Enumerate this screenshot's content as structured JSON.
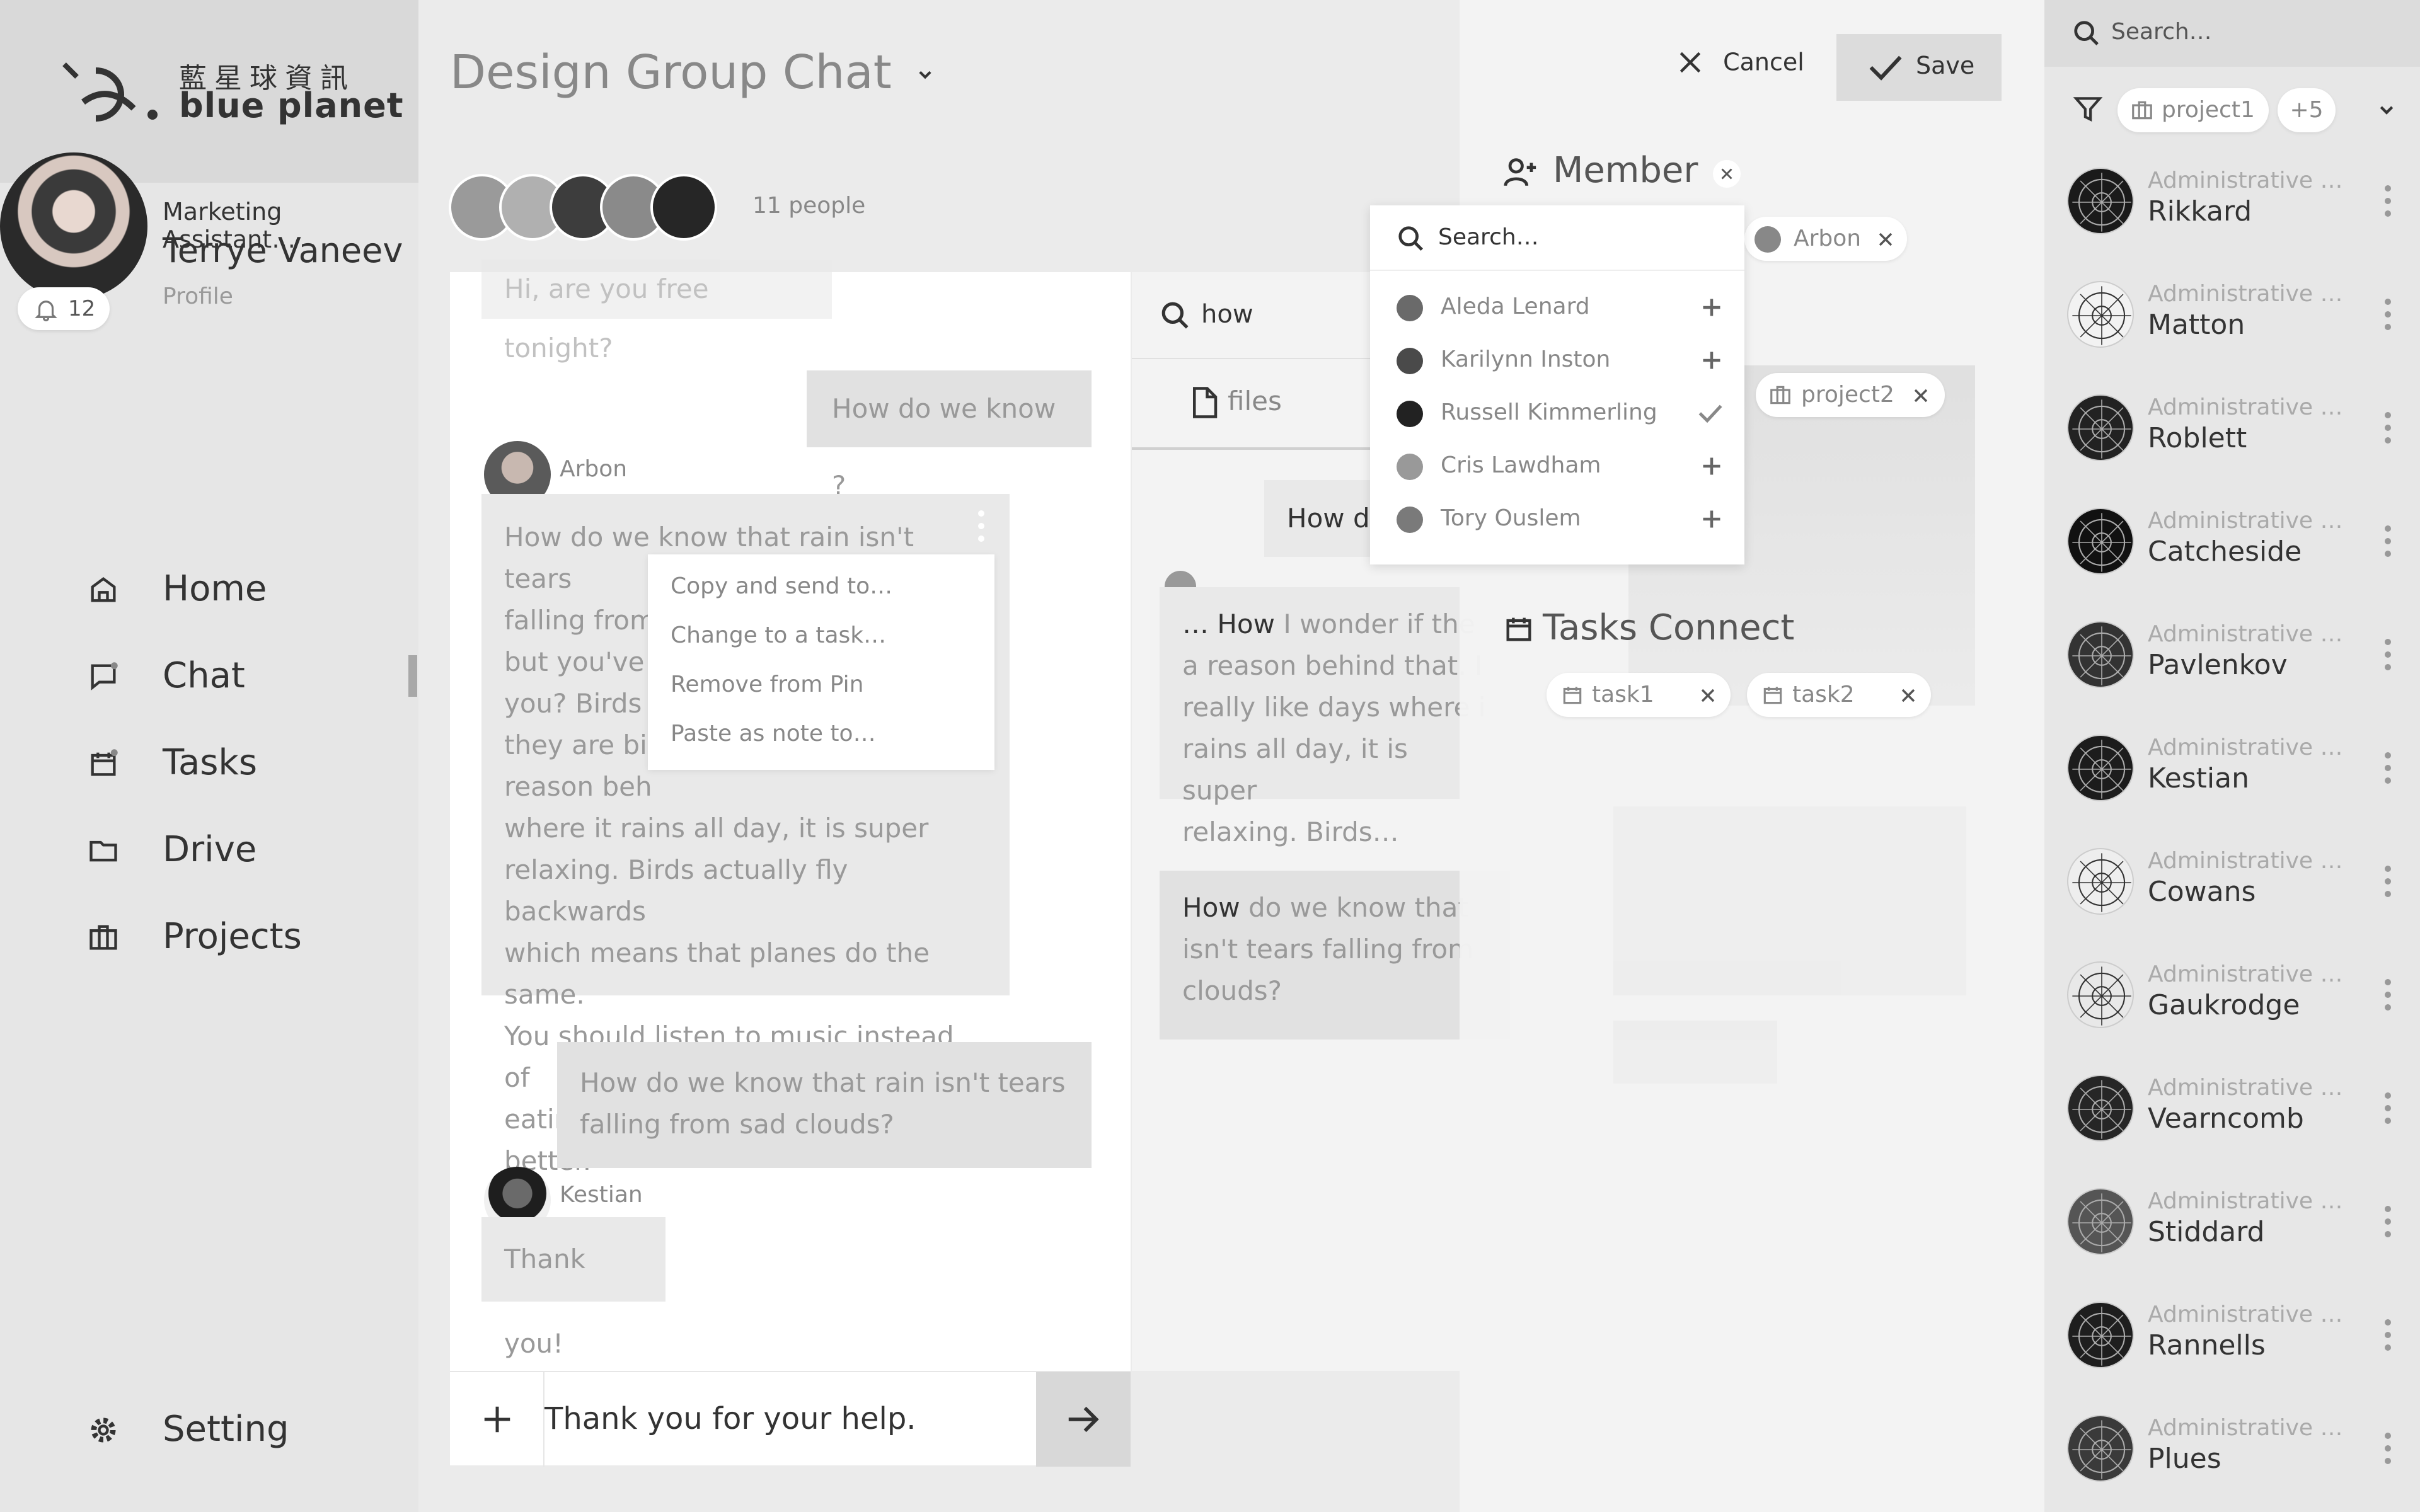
{
  "brand": {
    "cn": "藍星球資訊",
    "en": "blue planet"
  },
  "user": {
    "role": "Marketing Assistant…",
    "name": "Terrye Vaneev",
    "profile": "Profile",
    "notifications": "12"
  },
  "nav": {
    "home": "Home",
    "chat": "Chat",
    "tasks": "Tasks",
    "drive": "Drive",
    "projects": "Projects",
    "setting": "Setting"
  },
  "chat": {
    "title": "Design Group Chat",
    "people_count": "11 people",
    "messages": {
      "m0": "Hi, are you free tonight?",
      "m1": "How do we know ?",
      "arbon_name": "Arbon",
      "m2_l1": "How do we know that rain isn't tears",
      "m2_l2": "falling from",
      "m2_l3": "but you've r",
      "m2_l4": " you? Birds f",
      "m2_l5": "they are bird",
      "m2_l6": " reason beh",
      "m2_l7": "where it rains all day, it is super",
      "m2_l8": "relaxing. Birds actually fly backwards",
      "m2_l9": "which means that planes do the same.",
      "m2_l10": "You should listen to music instead of",
      "m2_l11": "eating. It makes you feel much better.",
      "m3_l1": "How do we know that rain isn't tears",
      "m3_l2": "falling from sad clouds?",
      "kestian_name": "Kestian",
      "m4": "Thank you!"
    },
    "context_menu": [
      "Copy and send to…",
      "Change to a task…",
      "Remove from Pin",
      "Paste as note to…"
    ],
    "composer": "Thank you for your help."
  },
  "search_col": {
    "query": "how",
    "files_tab": "files",
    "r1": "How d",
    "r2_l1_a": "… How",
    "r2_l1_b": " I wonder if the",
    "r2_l2": "a reason behind that. I",
    "r2_l3": "really like days where i",
    "r2_l4": "rains all day, it is super",
    "r2_l5": "relaxing. Birds…",
    "r3_l1_a": "How",
    "r3_l1_b": " do we know that",
    "r3_l2": "isn't tears falling from",
    "r3_l3": "clouds?"
  },
  "edit_panel": {
    "cancel": "Cancel",
    "save": "Save",
    "member_title": "Member",
    "member_chip": "Arbon",
    "project_chip": "project2",
    "tasks_title": "Tasks Connect",
    "task_chips": [
      "task1",
      "task2"
    ]
  },
  "member_dropdown": {
    "search": "Search…",
    "items": [
      "Aleda Lenard",
      "Karilynn Inston",
      "Russell Kimmerling",
      "Cris Lawdham",
      "Tory Ouslem"
    ]
  },
  "right_list": {
    "search": "Search…",
    "filter_chip": "project1",
    "filter_more": "+5",
    "role": "Administrative O…",
    "people": [
      "Rikkard",
      "Matton",
      "Roblett",
      "Catcheside",
      "Pavlenkov",
      "Kestian",
      "Cowans",
      "Gaukrodge",
      "Vearncomb",
      "Stiddard",
      "Rannells",
      "Plues"
    ]
  }
}
